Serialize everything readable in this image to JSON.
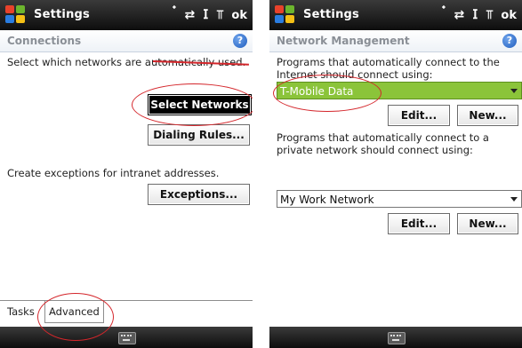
{
  "left_panel": {
    "topbar": {
      "title": "Settings",
      "ok_label": "ok"
    },
    "subheader": {
      "title": "Connections",
      "help": "?"
    },
    "description": "Select which networks are automatically used.",
    "select_networks_button": "Select Networks",
    "dialing_rules_button": "Dialing Rules...",
    "exceptions_text": "Create exceptions for intranet addresses.",
    "exceptions_button": "Exceptions...",
    "tabs": [
      {
        "label": "Tasks"
      },
      {
        "label": "Advanced"
      }
    ]
  },
  "right_panel": {
    "topbar": {
      "title": "Settings",
      "ok_label": "ok"
    },
    "subheader": {
      "title": "Network Management",
      "help": "?"
    },
    "internet_label": "Programs that automatically connect to the Internet should connect using:",
    "internet_network": "T-Mobile Data",
    "edit_button_1": "Edit...",
    "new_button_1": "New...",
    "private_label": "Programs that automatically connect to a private network should connect using:",
    "private_network": "My Work Network",
    "edit_button_2": "Edit...",
    "new_button_2": "New..."
  },
  "colors": {
    "highlight_green": "#8bc43a",
    "annotation_red": "#d4262b",
    "title_bar": "#1a1a1a"
  },
  "icons": [
    "windows-start-icon",
    "bluetooth-icon",
    "data-sync-icon",
    "signal-icon",
    "speaker-icon",
    "help-icon",
    "keyboard-icon",
    "dropdown-caret-icon"
  ]
}
